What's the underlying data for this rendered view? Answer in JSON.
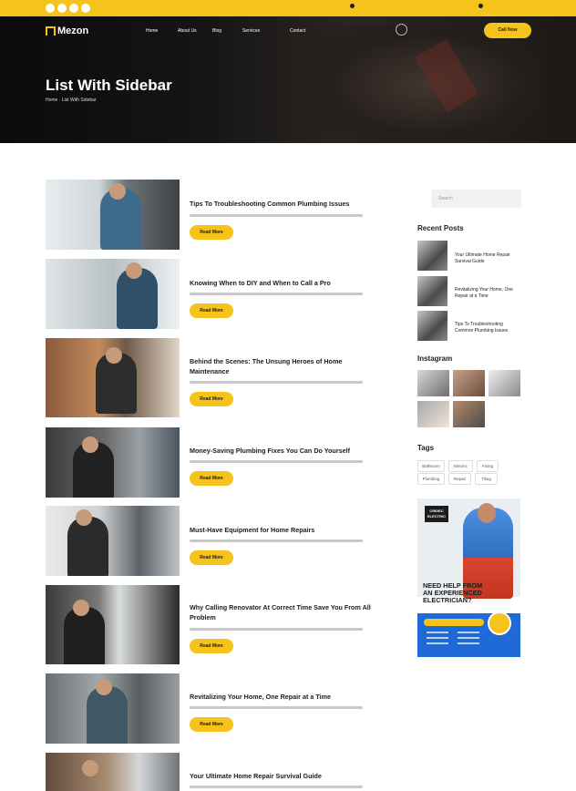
{
  "topbar": {
    "social_icons": [
      "facebook-icon",
      "twitter-icon",
      "instagram-icon",
      "youtube-icon"
    ],
    "left_info": "",
    "right_info": ""
  },
  "header": {
    "logo": "Mezon",
    "nav": [
      "Home",
      "About Us",
      "Blog",
      "Services",
      "Contact"
    ],
    "contact_label": "",
    "contact_phone": "",
    "cta": "Call Now"
  },
  "hero": {
    "title": "List With Sidebar",
    "breadcrumb": "Home  ·  List With Sidebar"
  },
  "posts": [
    {
      "date": "",
      "title": "Tips To Troubleshooting Common Plumbing Issues",
      "button": "Read More"
    },
    {
      "date": "",
      "title": "Knowing When to DIY and When to Call a Pro",
      "button": "Read More"
    },
    {
      "date": "",
      "title": "Behind the Scenes: The Unsung Heroes of Home Maintenance",
      "button": "Read More"
    },
    {
      "date": "",
      "title": "Money-Saving Plumbing Fixes You Can Do Yourself",
      "button": "Read More"
    },
    {
      "date": "",
      "title": "Must-Have Equipment for Home Repairs",
      "button": "Read More"
    },
    {
      "date": "",
      "title": "Why Calling Renovator At Correct Time Save You From All Problem",
      "button": "Read More"
    },
    {
      "date": "",
      "title": "Revitalizing Your Home, One Repair at a Time",
      "button": "Read More"
    },
    {
      "date": "",
      "title": "Your Ultimate Home Repair Survival Guide",
      "button": ""
    }
  ],
  "sidebar": {
    "search_placeholder": "Search",
    "recent_posts_title": "Recent Posts",
    "recent_posts": [
      {
        "date": "",
        "title": "Your Ultimate Home Repair Survival Guide"
      },
      {
        "date": "",
        "title": "Revitalizing Your Home, One Repair at a Time"
      },
      {
        "date": "",
        "title": "Tips To Troubleshooting Common Plumbing Issues"
      }
    ],
    "instagram_title": "Instagram",
    "tags_title": "Tags",
    "tags": [
      "Bathroom",
      "Electric",
      "Fixing",
      "Plumbing",
      "Repair",
      "Tiling"
    ],
    "ad": {
      "badge": "CRIDEC ELECTRIC",
      "headline": "NEED HELP FROM AN EXPERIENCED ELECTRICIAN?"
    }
  }
}
